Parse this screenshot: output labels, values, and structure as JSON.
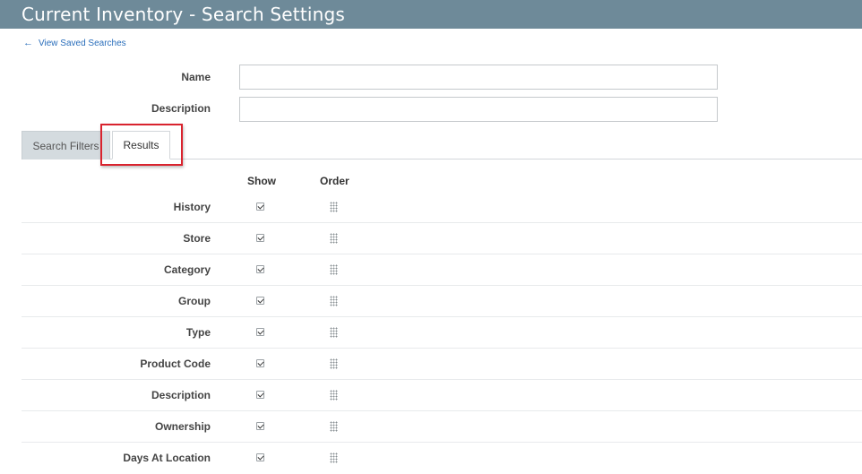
{
  "header": {
    "title": "Current Inventory - Search Settings"
  },
  "nav": {
    "back_link": "View Saved Searches"
  },
  "form": {
    "name_label": "Name",
    "name_value": "",
    "description_label": "Description",
    "description_value": ""
  },
  "tabs": [
    {
      "label": "Search Filters",
      "active": false
    },
    {
      "label": "Results",
      "active": true
    }
  ],
  "results": {
    "columns": {
      "show": "Show",
      "order": "Order"
    },
    "rows": [
      {
        "label": "History",
        "show": true
      },
      {
        "label": "Store",
        "show": true
      },
      {
        "label": "Category",
        "show": true
      },
      {
        "label": "Group",
        "show": true
      },
      {
        "label": "Type",
        "show": true
      },
      {
        "label": "Product Code",
        "show": true
      },
      {
        "label": "Description",
        "show": true
      },
      {
        "label": "Ownership",
        "show": true
      },
      {
        "label": "Days At Location",
        "show": true
      }
    ]
  },
  "colors": {
    "header_bg": "#6e8a99",
    "link": "#2a6ebb",
    "highlight": "#d9232e",
    "inactive_tab_bg": "#d4dbdf"
  },
  "icons": {
    "back": "arrow-left-icon",
    "checkbox": "checkbox-checked-icon",
    "order": "drag-handle-icon"
  }
}
